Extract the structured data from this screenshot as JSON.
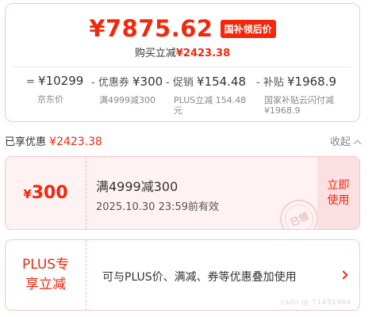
{
  "summary": {
    "price": "¥7875.62",
    "price_tag": "国补领后价",
    "save_label": "购买立减",
    "save_value": "¥2423.38",
    "breakdown": [
      {
        "operator": "=",
        "value": "¥10299",
        "label": "京东价"
      },
      {
        "operator": "-",
        "prefix": "优惠券",
        "value": "¥300",
        "label": "满4999减300"
      },
      {
        "operator": "-",
        "prefix": "促销",
        "value": "¥154.48",
        "label": "PLUS立减 154.48元"
      },
      {
        "operator": "-",
        "prefix": "补贴",
        "value": "¥1968.9",
        "label": "国家补贴云闪付减¥1968.9"
      }
    ]
  },
  "discount_header": {
    "label": "已享优惠",
    "value": "¥2423.38",
    "collapse_label": "收起"
  },
  "coupon": {
    "currency": "¥",
    "amount": "300",
    "condition": "满4999减300",
    "validity": "2025.10.30 23:59前有效",
    "button_label": "立即使用",
    "stamp_text": "已领"
  },
  "plus": {
    "title": "PLUS专享立减",
    "description": "可与PLUS价、满减、券等优惠叠加使用"
  },
  "watermark": "csdn @ 71491964"
}
